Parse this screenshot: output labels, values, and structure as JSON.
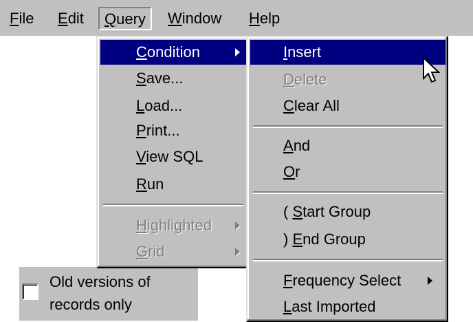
{
  "menubar": {
    "items": [
      {
        "pre": "",
        "acc": "F",
        "post": "ile"
      },
      {
        "pre": "",
        "acc": "E",
        "post": "dit"
      },
      {
        "pre": "",
        "acc": "Q",
        "post": "uery"
      },
      {
        "pre": "",
        "acc": "W",
        "post": "indow"
      },
      {
        "pre": "",
        "acc": "H",
        "post": "elp"
      }
    ]
  },
  "query_menu": {
    "items": [
      {
        "pre": "",
        "acc": "C",
        "post": "ondition"
      },
      {
        "pre": "",
        "acc": "S",
        "post": "ave..."
      },
      {
        "pre": "",
        "acc": "L",
        "post": "oad..."
      },
      {
        "pre": "",
        "acc": "P",
        "post": "rint..."
      },
      {
        "pre": "",
        "acc": "V",
        "post": "iew SQL"
      },
      {
        "pre": "",
        "acc": "R",
        "post": "un"
      },
      {
        "pre": "",
        "acc": "H",
        "post": "ighlighted"
      },
      {
        "pre": "",
        "acc": "G",
        "post": "rid"
      }
    ]
  },
  "condition_menu": {
    "items": [
      {
        "pre": "",
        "acc": "I",
        "post": "nsert"
      },
      {
        "pre": "",
        "acc": "D",
        "post": "elete"
      },
      {
        "pre": "",
        "acc": "C",
        "post": "lear All"
      },
      {
        "pre": "",
        "acc": "A",
        "post": "nd"
      },
      {
        "pre": "",
        "acc": "O",
        "post": "r"
      },
      {
        "pre": "( ",
        "acc": "S",
        "post": "tart Group"
      },
      {
        "pre": ") ",
        "acc": "E",
        "post": "nd Group"
      },
      {
        "pre": "",
        "acc": "F",
        "post": "requency Select"
      },
      {
        "pre": "",
        "acc": "L",
        "post": "ast Imported"
      }
    ]
  },
  "checkbox": {
    "line1": "Old versions of",
    "line2": "records only",
    "checked": false
  },
  "colors": {
    "face": "#c0c0c0",
    "highlight": "#000080",
    "disabled_text": "#808080"
  }
}
